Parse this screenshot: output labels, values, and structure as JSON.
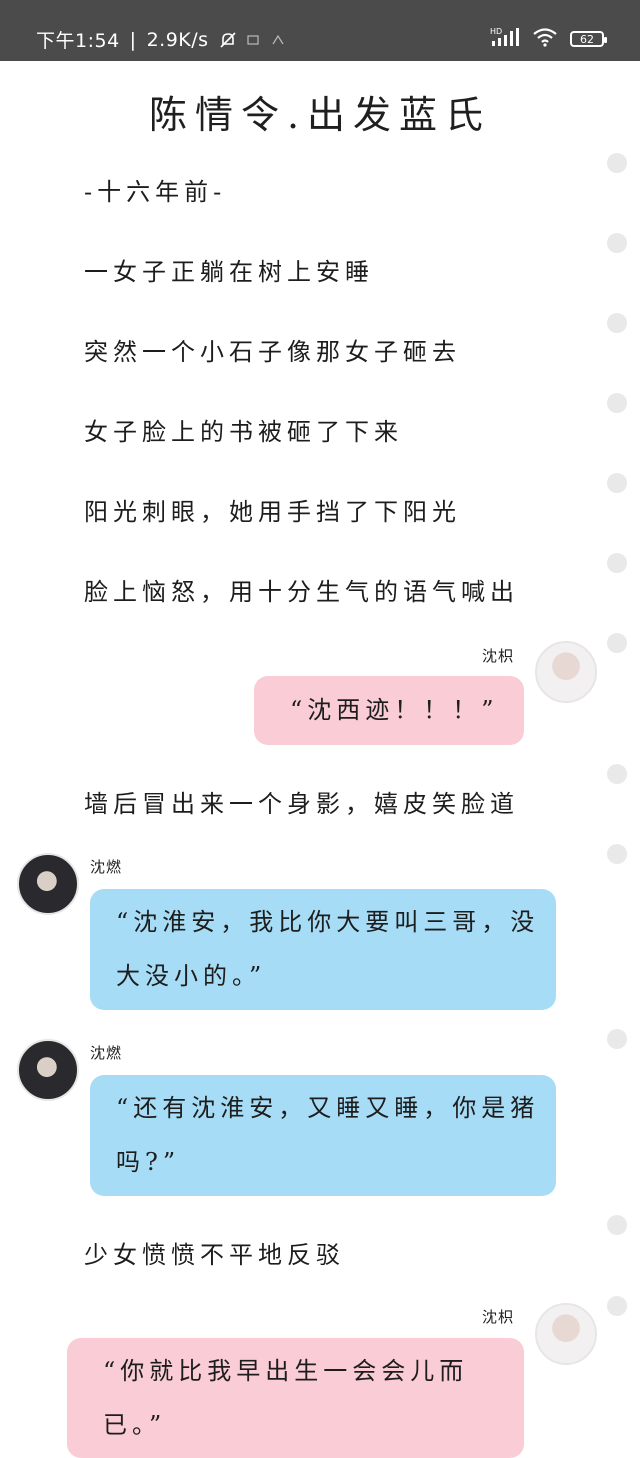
{
  "status_bar": {
    "time": "下午1:54",
    "net_speed": "2.9K/s",
    "network": "HD",
    "battery": "62"
  },
  "story": {
    "title": "陈情令.出发蓝氏",
    "lines": [
      "-十六年前-",
      "一女子正躺在树上安睡",
      "突然一个小石子像那女子砸去",
      "女子脸上的书被砸了下来",
      "阳光刺眼，她用手挡了下阳光",
      "脸上恼怒，用十分生气的语气喊出",
      "墙后冒出来一个身影，嬉皮笑脸道",
      "少女愤愤不平地反驳"
    ]
  },
  "messages": [
    {
      "speaker": "沈枳",
      "text": "“沈西迹！！！”"
    },
    {
      "speaker": "沈燃",
      "line1": "“沈淮安，我比你大要叫三哥，没",
      "line2": "大没小的。”"
    },
    {
      "speaker": "沈燃",
      "line1": "“还有沈淮安，又睡又睡，你是猪",
      "line2": "吗?”"
    },
    {
      "speaker": "沈枳",
      "line1": "“你就比我早出生一会会儿而",
      "line2": "已。”"
    }
  ],
  "colors": {
    "status_bar": "#4b4b4b",
    "pink_bubble": "#f9ccd6",
    "blue_bubble": "#a6dcf5",
    "rail_dot": "#e9e9ea"
  }
}
